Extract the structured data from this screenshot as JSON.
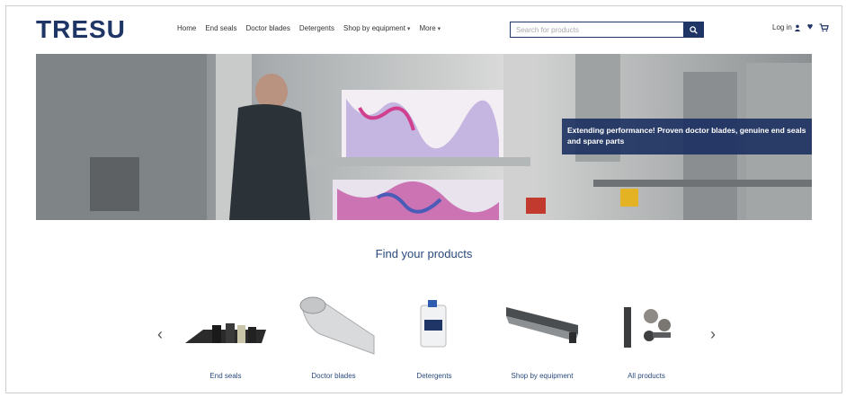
{
  "brand": {
    "logo_text": "TRESU",
    "color_primary": "#1f3566"
  },
  "nav": {
    "items": [
      {
        "label": "Home"
      },
      {
        "label": "End seals"
      },
      {
        "label": "Doctor blades"
      },
      {
        "label": "Detergents"
      },
      {
        "label": "Shop by equipment",
        "has_dropdown": true
      },
      {
        "label": "More",
        "has_dropdown": true
      }
    ]
  },
  "search": {
    "placeholder": "Search for products",
    "button_icon": "search-icon"
  },
  "account": {
    "login_label": "Log in",
    "icons": [
      "user-icon",
      "heart-icon",
      "cart-icon"
    ]
  },
  "hero": {
    "caption": "Extending performance! Proven doctor blades, genuine end seals and spare parts"
  },
  "products_section": {
    "title": "Find your products",
    "prev_icon": "chevron-left-icon",
    "next_icon": "chevron-right-icon",
    "items": [
      {
        "label": "End seals"
      },
      {
        "label": "Doctor blades"
      },
      {
        "label": "Detergents"
      },
      {
        "label": "Shop by equipment"
      },
      {
        "label": "All products"
      }
    ]
  }
}
